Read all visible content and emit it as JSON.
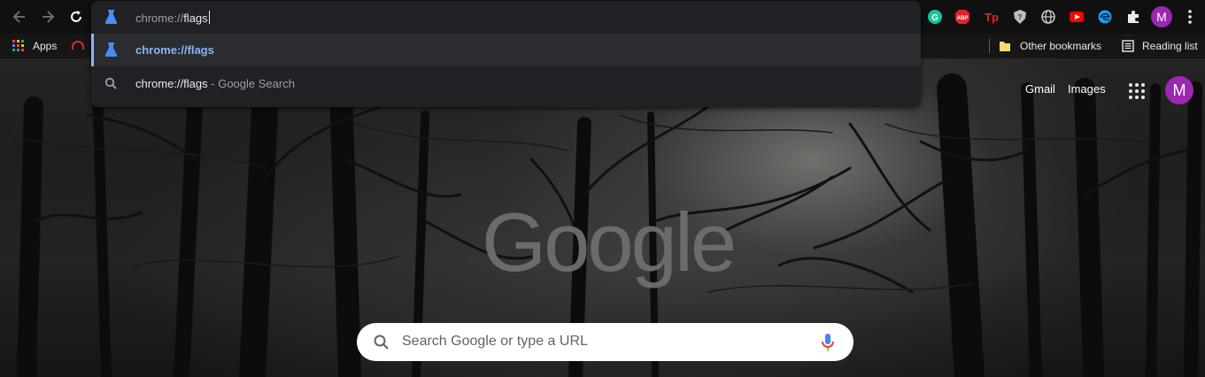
{
  "omnibox": {
    "typed_prefix": "chrome://",
    "typed_suffix": "flags",
    "suggestions": [
      {
        "text": "chrome://flags",
        "suffix": "",
        "icon": "flask-icon",
        "selected": true
      },
      {
        "text": "chrome://flags",
        "suffix": " - Google Search",
        "icon": "search-icon",
        "selected": false
      }
    ]
  },
  "bookmarks": {
    "apps_label": "Apps",
    "other_bookmarks": "Other bookmarks",
    "reading_list": "Reading list"
  },
  "profile": {
    "initial": "M",
    "color": "#9c27b0"
  },
  "ntp": {
    "gmail": "Gmail",
    "images": "Images",
    "logo": "Google",
    "search_placeholder": "Search Google or type a URL",
    "avatar_initial": "M"
  },
  "extensions": [
    "grammarly-icon",
    "adblock-plus-icon",
    "tp-icon",
    "shield-icon",
    "globe-icon",
    "youtube-icon",
    "edge-icon",
    "puzzle-icon"
  ],
  "colors": {
    "accent": "#8ab4f8",
    "avatar": "#9c27b0",
    "suggestion_link": "#8ab4f8"
  }
}
